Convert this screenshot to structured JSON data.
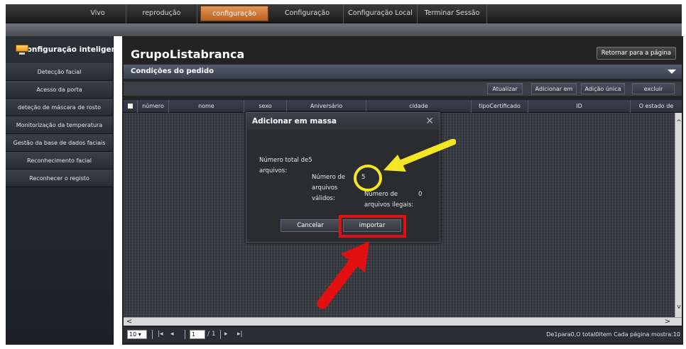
{
  "nav": {
    "tabs": [
      {
        "label": "Vivo",
        "active": false
      },
      {
        "label": "reprodução",
        "active": false
      },
      {
        "label": "configuração",
        "active": true
      },
      {
        "label": "Configuração",
        "active": false
      },
      {
        "label": "Configuração Local",
        "active": false
      },
      {
        "label": "Terminar Sessão",
        "active": false
      }
    ]
  },
  "sidebar": {
    "title": "Configuração inteligente",
    "title_icon": "monitor-icon",
    "items": [
      {
        "label": "Detecção facial"
      },
      {
        "label": "Acesso da porta"
      },
      {
        "label": "deteção de máscara de rosto"
      },
      {
        "label": "Monitorização da temperatura"
      },
      {
        "label": "Gestão da base de dados faciais"
      },
      {
        "label": "Reconhecimento facial"
      },
      {
        "label": "Reconhecer o registo"
      }
    ]
  },
  "main": {
    "title": "GrupoListabranca",
    "back_button": "Retornar para a página",
    "conditions_label": "Condições do pedido",
    "toolbar": {
      "refresh": "Atualizar",
      "add_in": "Adicionar em",
      "add_single": "Adição única",
      "delete": "excluir"
    },
    "columns": [
      "número",
      "nome",
      "sexo",
      "Aniversário",
      "cidade",
      "tipoCertificado",
      "ID",
      "O estado de"
    ],
    "pager": {
      "page_size": "10",
      "page_current": "1",
      "page_total": "/ 1",
      "summary": "De1para0,O total0item Cada página mostra:10"
    }
  },
  "modal": {
    "title": "Adicionar em massa",
    "total_label_1": "Número total de",
    "total_label_2": "arquivos:",
    "total_value": "5",
    "valid_label_1": "Número de",
    "valid_label_2": "arquivos",
    "valid_label_3": "válidos:",
    "valid_value": "5",
    "illegal_label_1": "Número de",
    "illegal_label_2": "arquivos ilegais:",
    "illegal_value": "0",
    "cancel": "Cancelar",
    "import": "importar"
  },
  "colors": {
    "active_tab": "#d07a3c",
    "highlight_circle": "#f4e624",
    "highlight_box": "#e21010",
    "arrow_yellow": "#f4e624",
    "arrow_red": "#e21010"
  }
}
